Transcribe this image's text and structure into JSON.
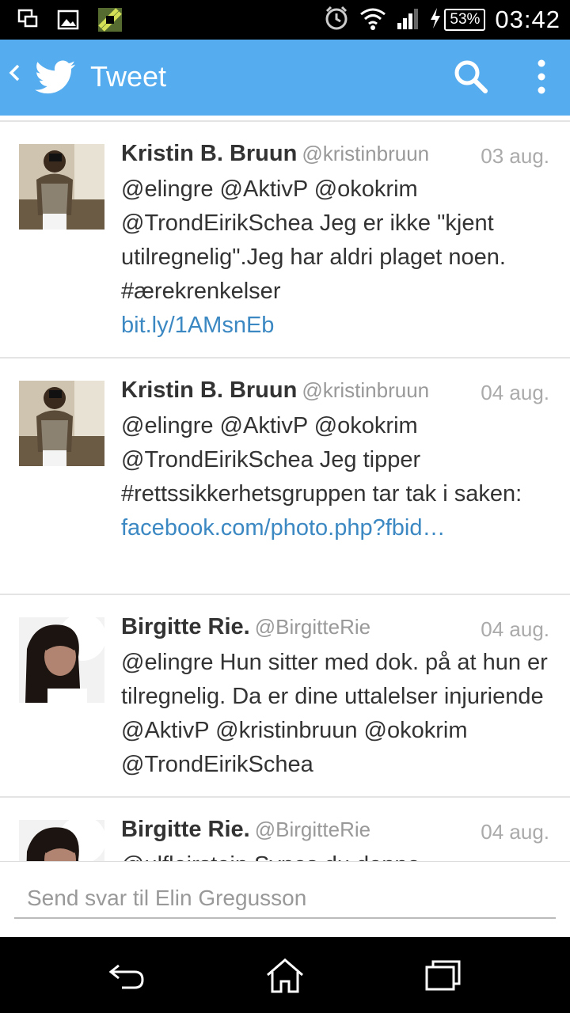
{
  "status_bar": {
    "time": "03:42",
    "battery": "53%",
    "icons": [
      "screenshot-icon",
      "gallery-icon",
      "app-icon",
      "alarm-icon",
      "wifi-icon",
      "signal-icon",
      "charging-icon",
      "battery-icon"
    ]
  },
  "app_bar": {
    "title": "Tweet",
    "icons": [
      "back-icon",
      "twitter-bird-icon",
      "search-icon",
      "overflow-menu-icon"
    ]
  },
  "tweets": [
    {
      "name": "Kristin B. Bruun",
      "handle": "@kristinbruun",
      "date": "03 aug.",
      "text": "@elingre @AktivP @okokrim @TrondEirikSchea Jeg er ikke \"kjent utilregnelig\".Jeg har aldri plaget noen. #ærekrenkelser",
      "link": "bit.ly/1AMsnEb"
    },
    {
      "name": "Kristin B. Bruun",
      "handle": "@kristinbruun",
      "date": "04 aug.",
      "text": "@elingre @AktivP @okokrim @TrondEirikSchea Jeg tipper #rettssikkerhetsgruppen tar tak i saken:",
      "link": "facebook.com/photo.php?fbid…"
    },
    {
      "name": "Birgitte Rie.",
      "handle": "@BirgitteRie",
      "date": "04 aug.",
      "text": "@elingre  Hun sitter med dok. på at hun er tilregnelig. Da er dine uttalelser injuriende @AktivP @kristinbruun @okokrim @TrondEirikSchea",
      "link": ""
    },
    {
      "name": "Birgitte Rie.",
      "handle": "@BirgitteRie",
      "date": "04 aug.",
      "text": "@ulfleirstein Synes du denne",
      "link": ""
    }
  ],
  "compose": {
    "placeholder": "Send svar til Elin Gregusson"
  },
  "nav_bar": {
    "icons": [
      "back-nav-icon",
      "home-icon",
      "recents-icon"
    ]
  }
}
